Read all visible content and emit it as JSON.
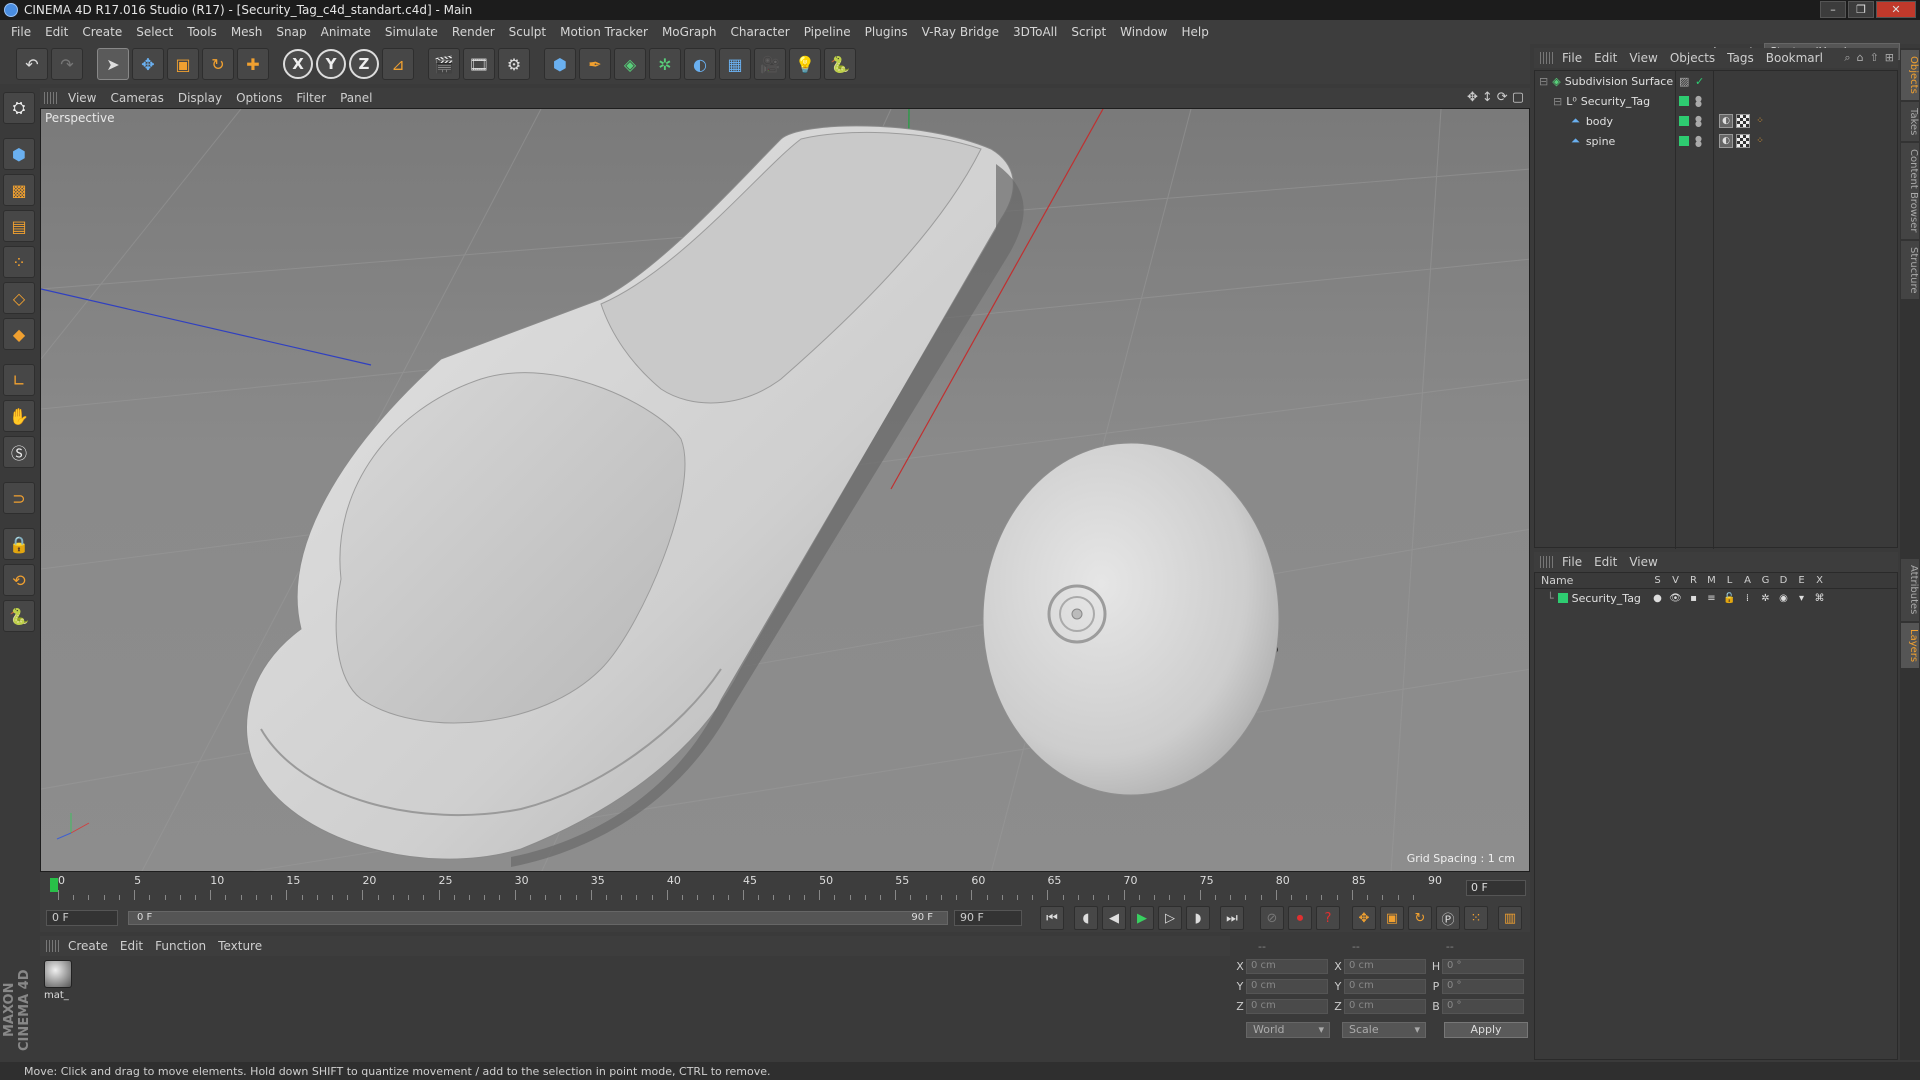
{
  "window": {
    "title": "CINEMA 4D R17.016 Studio (R17) - [Security_Tag_c4d_standart.c4d] - Main"
  },
  "menu": [
    "File",
    "Edit",
    "Create",
    "Select",
    "Tools",
    "Mesh",
    "Snap",
    "Animate",
    "Simulate",
    "Render",
    "Sculpt",
    "Motion Tracker",
    "MoGraph",
    "Character",
    "Pipeline",
    "Plugins",
    "V-Ray Bridge",
    "3DToAll",
    "Script",
    "Window",
    "Help"
  ],
  "layout": {
    "label": "Layout:",
    "value": "Startup (User)"
  },
  "toolbar": {
    "axis_x": "X",
    "axis_y": "Y",
    "axis_z": "Z"
  },
  "viewport": {
    "menu": [
      "View",
      "Cameras",
      "Display",
      "Options",
      "Filter",
      "Panel"
    ],
    "label": "Perspective",
    "grid_spacing": "Grid Spacing : 1 cm"
  },
  "timeline": {
    "ticks": [
      "0",
      "5",
      "10",
      "15",
      "20",
      "25",
      "30",
      "35",
      "40",
      "45",
      "50",
      "55",
      "60",
      "65",
      "70",
      "75",
      "80",
      "85",
      "90"
    ],
    "current_frame": "0 F"
  },
  "transport": {
    "start_frame": "0 F",
    "range_start": "0 F",
    "range_end": "90 F",
    "end_frame": "90 F"
  },
  "material_manager": {
    "menu": [
      "Create",
      "Edit",
      "Function",
      "Texture"
    ],
    "materials": [
      "mat_"
    ]
  },
  "brand": "MAXON CINEMA 4D",
  "coordinates": {
    "headers": [
      "--",
      "--",
      "--"
    ],
    "rows": [
      {
        "l1": "X",
        "v1": "0 cm",
        "l2": "X",
        "v2": "0 cm",
        "l3": "H",
        "v3": "0 °"
      },
      {
        "l1": "Y",
        "v1": "0 cm",
        "l2": "Y",
        "v2": "0 cm",
        "l3": "P",
        "v3": "0 °"
      },
      {
        "l1": "Z",
        "v1": "0 cm",
        "l2": "Z",
        "v2": "0 cm",
        "l3": "B",
        "v3": "0 °"
      }
    ],
    "space": "World",
    "mode": "Scale",
    "apply_label": "Apply"
  },
  "object_manager": {
    "menu": [
      "File",
      "Edit",
      "View",
      "Objects",
      "Tags",
      "Bookmarl"
    ],
    "objects": [
      {
        "name": "Subdivision Surface",
        "indent": 0
      },
      {
        "name": "Security_Tag",
        "indent": 1
      },
      {
        "name": "body",
        "indent": 2
      },
      {
        "name": "spine",
        "indent": 2
      }
    ]
  },
  "layer_manager": {
    "menu": [
      "File",
      "Edit",
      "View"
    ],
    "header_name": "Name",
    "columns": [
      "S",
      "V",
      "R",
      "M",
      "L",
      "A",
      "G",
      "D",
      "E",
      "X"
    ],
    "layers": [
      {
        "name": "Security_Tag"
      }
    ]
  },
  "side_tabs": [
    "Objects",
    "Takes",
    "Content Browser",
    "Structure",
    "Attributes",
    "Layers"
  ],
  "status": "Move: Click and drag to move elements. Hold down SHIFT to quantize movement / add to the selection in point mode, CTRL to remove.",
  "colors": {
    "accent": "#f0a030",
    "layer_green": "#2ecc71",
    "playhead": "#28c048"
  }
}
